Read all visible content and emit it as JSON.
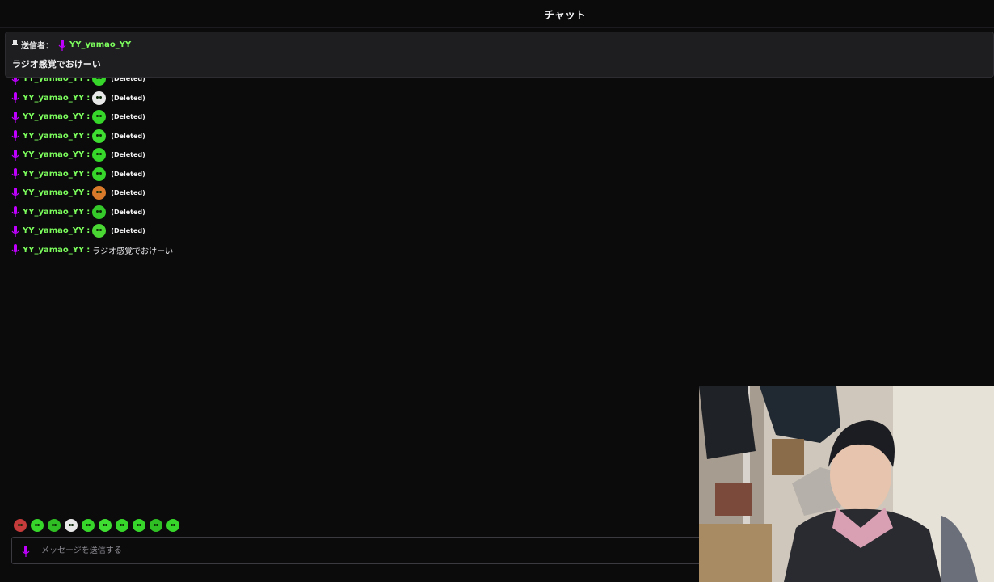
{
  "header": {
    "title": "チャット"
  },
  "pinned": {
    "sender_label": "送信者：",
    "user": "YY_yamao_YY",
    "message": "ラジオ感覚でおけーい"
  },
  "chat": {
    "messages": [
      {
        "user": "YY_yamao_YY",
        "colon": ":",
        "emote": "green-ghost-emote",
        "text": "(Deleted)"
      },
      {
        "user": "YY_yamao_YY",
        "colon": ":",
        "emote": "panda-face-emote",
        "text": "(Deleted)"
      },
      {
        "user": "YY_yamao_YY",
        "colon": ":",
        "emote": "green-blob-emote",
        "text": "(Deleted)"
      },
      {
        "user": "YY_yamao_YY",
        "colon": ":",
        "emote": "green-alien-emote",
        "text": "(Deleted)"
      },
      {
        "user": "YY_yamao_YY",
        "colon": ":",
        "emote": "green-blob-emote",
        "text": "(Deleted)"
      },
      {
        "user": "YY_yamao_YY",
        "colon": ":",
        "emote": "green-blob-emote",
        "text": "(Deleted)"
      },
      {
        "user": "YY_yamao_YY",
        "colon": ":",
        "emote": "red-eyes-emote",
        "text": "(Deleted)"
      },
      {
        "user": "YY_yamao_YY",
        "colon": ":",
        "emote": "green-dizzy-emote",
        "text": "(Deleted)"
      },
      {
        "user": "YY_yamao_YY",
        "colon": ":",
        "emote": "green-red-emote",
        "text": "(Deleted)"
      },
      {
        "user": "YY_yamao_YY",
        "colon": ":",
        "emote": "",
        "text": "ラジオ感覚でおけーい"
      }
    ]
  },
  "emote_bar": [
    "red-green-emote",
    "green-ghost-emote",
    "green-box-emote",
    "panda-emote",
    "green-blob-emote",
    "green-alien-emote",
    "green-blob-emote",
    "green-blob-emote",
    "green-small-emote",
    "green-blob-emote"
  ],
  "input": {
    "placeholder": "メッセージを送信する"
  },
  "colors": {
    "accent_user": "#7dff5d",
    "mic": "#c000ff",
    "background": "#0b0b0c",
    "emote_green": "#37d62a"
  }
}
